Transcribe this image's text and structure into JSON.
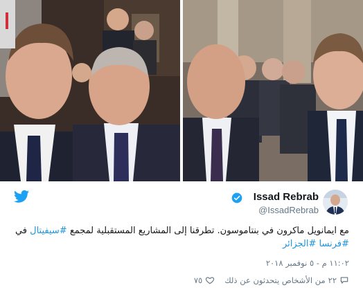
{
  "tweet": {
    "display_name": "Issad Rebrab",
    "handle": "@IssadRebrab",
    "text_plain": "مع ايمانويل ماكرون في بنتاموسون. تطرقنا إلى المشاريع المستقبلية لمجمع",
    "hashtags": [
      "#سيفيتال",
      "#فرنسا",
      "#الجزائر"
    ],
    "text_in": "في",
    "timestamp": "١١:٠٢ م - ٥ نوفمبر ٢٠١٨",
    "likes": "٧٥",
    "replies": "٢٢",
    "replies_caption": "من الأشخاص يتحدثون عن ذلك"
  },
  "colors": {
    "brand_blue": "#1da1f2",
    "hashtag_blue": "#1b95e0",
    "muted_text": "#657786",
    "main_text": "#14171a"
  },
  "icons": [
    "twitter-bird-icon",
    "verified-badge-icon",
    "heart-icon",
    "speech-bubble-icon"
  ]
}
